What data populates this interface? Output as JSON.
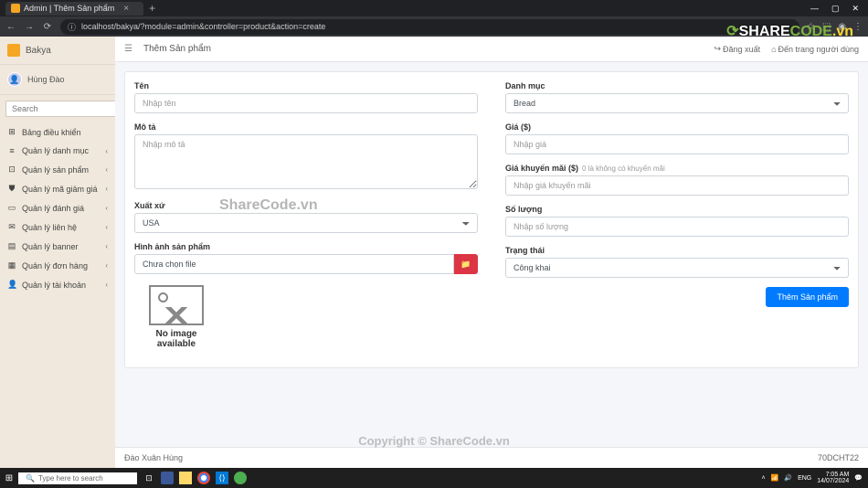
{
  "browser": {
    "tab_title": "Admin | Thêm Sản phẩm",
    "url": "localhost/bakya/?module=admin&controller=product&action=create"
  },
  "sidebar": {
    "brand": "Bakya",
    "user": "Hùng Đào",
    "search_placeholder": "Search",
    "items": [
      {
        "icon": "⊞",
        "label": "Bảng điều khiển",
        "chev": false
      },
      {
        "icon": "≡",
        "label": "Quản lý danh mục",
        "chev": true
      },
      {
        "icon": "⊡",
        "label": "Quản lý sản phẩm",
        "chev": true
      },
      {
        "icon": "⛊",
        "label": "Quản lý mã giảm giá",
        "chev": true
      },
      {
        "icon": "▭",
        "label": "Quản lý đánh giá",
        "chev": true
      },
      {
        "icon": "✉",
        "label": "Quản lý liên hệ",
        "chev": true
      },
      {
        "icon": "▤",
        "label": "Quản lý banner",
        "chev": true
      },
      {
        "icon": "▦",
        "label": "Quản lý đơn hàng",
        "chev": true
      },
      {
        "icon": "👤",
        "label": "Quản lý tài khoản",
        "chev": true
      }
    ]
  },
  "topbar": {
    "title": "Thêm Sản phẩm",
    "logout": "Đăng xuất",
    "userpage": "Đến trang người dùng"
  },
  "form": {
    "name_label": "Tên",
    "name_placeholder": "Nhập tên",
    "desc_label": "Mô tả",
    "desc_placeholder": "Nhập mô tả",
    "origin_label": "Xuất xứ",
    "origin_value": "USA",
    "image_label": "Hình ảnh sản phẩm",
    "image_value": "Chưa chọn file",
    "noimage_l1": "No image",
    "noimage_l2": "available",
    "category_label": "Danh mục",
    "category_value": "Bread",
    "price_label": "Giá ($)",
    "price_placeholder": "Nhập giá",
    "sale_label": "Giá khuyến mãi ($)",
    "sale_hint": "0 là không có khuyến mãi",
    "sale_placeholder": "Nhập giá khuyến mãi",
    "qty_label": "Số lượng",
    "qty_placeholder": "Nhập số lượng",
    "status_label": "Trạng thái",
    "status_value": "Công khai",
    "submit": "Thêm Sản phẩm"
  },
  "footer": {
    "left": "Đào Xuân Hùng",
    "right": "70DCHT22"
  },
  "watermark": {
    "text": "ShareCode.vn",
    "copyright": "Copyright © ShareCode.vn",
    "logo_share": "SHARE",
    "logo_code": "CODE",
    "logo_tld": ".vn"
  },
  "taskbar": {
    "search": "Type here to search",
    "time": "7:05 AM",
    "date": "14/07/2024"
  }
}
